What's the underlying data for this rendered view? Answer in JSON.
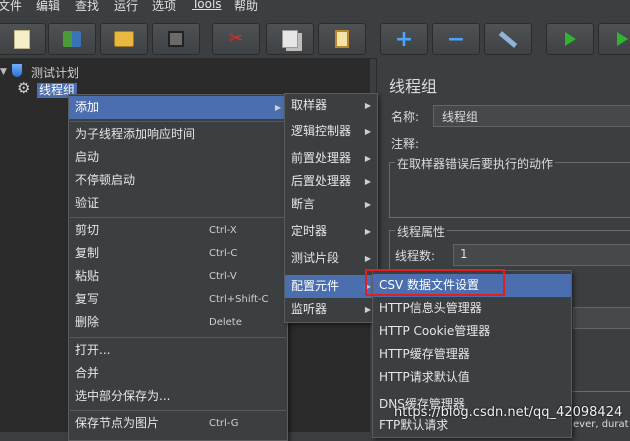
{
  "menubar": [
    "文件",
    "编辑",
    "查找",
    "运行",
    "选项",
    "Tools",
    "帮助"
  ],
  "toolbar": {
    "icons": [
      "new-icon",
      "templates-icon",
      "open-icon",
      "save-icon",
      "cut-icon",
      "copy-icon",
      "paste-icon",
      "add-icon",
      "remove-icon",
      "toggle-icon",
      "start-icon",
      "start-no-pause-icon"
    ],
    "plus": "+",
    "minus": "−"
  },
  "tree": {
    "root": "测试计划",
    "child": "线程组"
  },
  "context_menu": {
    "items": [
      {
        "label": "添加",
        "submenu": true,
        "selected": true
      },
      {
        "label": "为子线程添加响应时间"
      },
      {
        "label": "启动"
      },
      {
        "label": "不停顿启动"
      },
      {
        "label": "验证"
      },
      {
        "label": "剪切",
        "shortcut": "Ctrl-X"
      },
      {
        "label": "复制",
        "shortcut": "Ctrl-C"
      },
      {
        "label": "粘贴",
        "shortcut": "Ctrl-V"
      },
      {
        "label": "复写",
        "shortcut": "Ctrl+Shift-C"
      },
      {
        "label": "删除",
        "shortcut": "Delete"
      },
      {
        "label": "打开..."
      },
      {
        "label": "合并"
      },
      {
        "label": "选中部分保存为..."
      },
      {
        "label": "保存节点为图片",
        "shortcut": "Ctrl-G"
      }
    ]
  },
  "add_submenu": {
    "items": [
      {
        "label": "取样器"
      },
      {
        "label": "逻辑控制器"
      },
      {
        "label": "前置处理器"
      },
      {
        "label": "后置处理器"
      },
      {
        "label": "断言"
      },
      {
        "label": "定时器"
      },
      {
        "label": "测试片段"
      },
      {
        "label": "配置元件",
        "selected": true
      },
      {
        "label": "监听器"
      }
    ]
  },
  "config_submenu": {
    "items": [
      {
        "label": "CSV 数据文件设置",
        "selected": true
      },
      {
        "label": "HTTP信息头管理器"
      },
      {
        "label": "HTTP Cookie管理器"
      },
      {
        "label": "HTTP缓存管理器"
      },
      {
        "label": "HTTP请求默认值"
      },
      {
        "label": "DNS缓存管理器"
      },
      {
        "label": "FTP默认请求"
      }
    ]
  },
  "panel": {
    "title": "线程组",
    "name_label": "名称:",
    "name_value": "线程组",
    "comment_label": "注释:",
    "error_group": "在取样器错误后要执行的动作",
    "thread_props": "线程属性",
    "threads_label": "线程数:",
    "threads_value": "1",
    "overflow_text": "ever, durat"
  },
  "watermark": "https://blog.csdn.net/qq_42098424",
  "colors": {
    "highlight": "#4b6eaf",
    "annotation_box": "#e02020"
  }
}
